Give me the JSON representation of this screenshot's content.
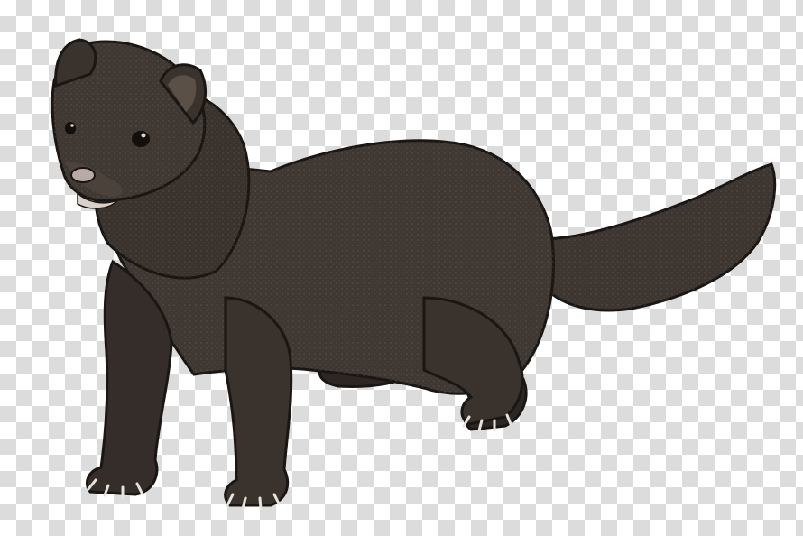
{
  "image": {
    "subject": "mink",
    "background": "transparency-checkerboard",
    "colors": {
      "fur": "#3f3731",
      "fur_dark": "#2a2420",
      "fur_light": "#6a5f56",
      "outline": "#1a1613",
      "nose": "#b9aaa6",
      "eye": "#120f0d",
      "claw": "#e6e2dc",
      "checker_light": "#ffffff",
      "checker_dark": "#dcdcdc"
    }
  }
}
